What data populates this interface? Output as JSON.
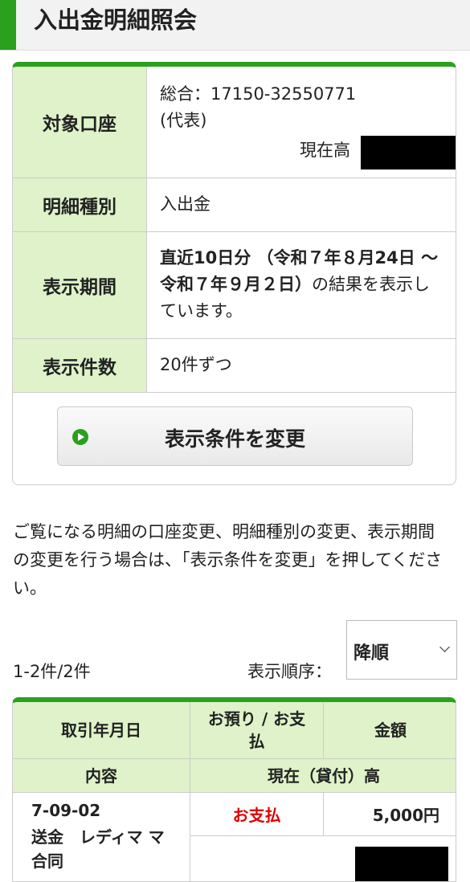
{
  "header": {
    "title": "入出金明細照会"
  },
  "account_info": {
    "rows": [
      {
        "label": "対象口座",
        "account": "総合：17150-32550771",
        "account_note": "(代表)",
        "balance_label": "現在高"
      },
      {
        "label": "明細種別",
        "value": "入出金"
      },
      {
        "label": "表示期間",
        "value_bold": "直近10日分 （令和７年８月24日 ～ 令和７年９月２日）",
        "value_rest": "の結果を表示しています。"
      },
      {
        "label": "表示件数",
        "value": "20件ずつ"
      }
    ],
    "change_button": "表示条件を変更"
  },
  "notice": "ご覧になる明細の口座変更、明細種別の変更、表示期間の変更を行う場合は、「表示条件を変更」を押してください。",
  "list_controls": {
    "count": "1-2件/2件",
    "order_label": "表示順序：",
    "order_value": "降順"
  },
  "transactions": {
    "headers": {
      "date": "取引年月日",
      "type": "お預り / お支払",
      "amount": "金額",
      "content": "内容",
      "balance": "現在（貸付）高"
    },
    "rows": [
      {
        "date": "7-09-02",
        "content": "送金　レディマ マ　合同",
        "type": "お支払",
        "amount": "5,000円"
      }
    ]
  },
  "colors": {
    "accent": "#2aa01e",
    "header_cell": "#dff2c9",
    "payment": "#e00000"
  }
}
